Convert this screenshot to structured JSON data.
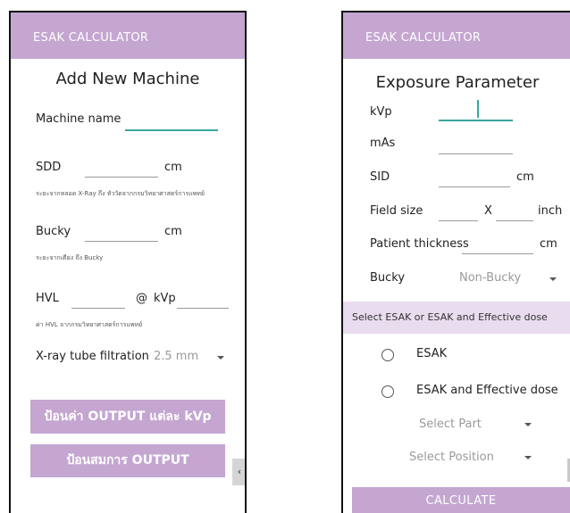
{
  "left": {
    "appbar_title": "ESAK CALCULATOR",
    "page_title": "Add New Machine",
    "machine_name_label": "Machine name",
    "sdd_label": "SDD",
    "sdd_unit": "cm",
    "sdd_hint": "ระยะจากหลอด X-Ray ถึง หัววัดจากกรมวิทยาศาสตร์การแพทย์",
    "bucky_label": "Bucky",
    "bucky_unit": "cm",
    "bucky_hint": "ระยะจากเตียง ถึง Bucky",
    "hvl_label": "HVL",
    "hvl_at": "@",
    "hvl_kvp": "kVp",
    "hvl_hint": "ค่า HVL จากกรมวิทยาศาสตร์การแพทย์",
    "filtration_label": "X-ray tube filtration",
    "filtration_value": "2.5 mm",
    "btn_output_kvp": "ป้อนค่า OUTPUT แต่ละ kVp",
    "btn_output_eq": "ป้อนสมการ OUTPUT",
    "side_tab": "‹"
  },
  "right": {
    "appbar_title": "ESAK CALCULATOR",
    "page_title": "Exposure Parameter",
    "kvp_label": "kVp",
    "mas_label": "mAs",
    "sid_label": "SID",
    "sid_unit": "cm",
    "field_label": "Field size",
    "field_x": "X",
    "field_unit": "inch",
    "thickness_label": "Patient thickness",
    "thickness_unit": "cm",
    "bucky_label": "Bucky",
    "bucky_value": "Non-Bucky",
    "section_label": "Select ESAK or ESAK and Effective dose",
    "opt_esak": "ESAK",
    "opt_esak_eff": "ESAK and Effective dose",
    "select_part": "Select Part",
    "select_position": "Select Position",
    "calculate": "CALCULATE"
  },
  "colors": {
    "appbar": "#c4a6d1",
    "section": "#e8dcee",
    "focus_line": "#3aa79f"
  }
}
